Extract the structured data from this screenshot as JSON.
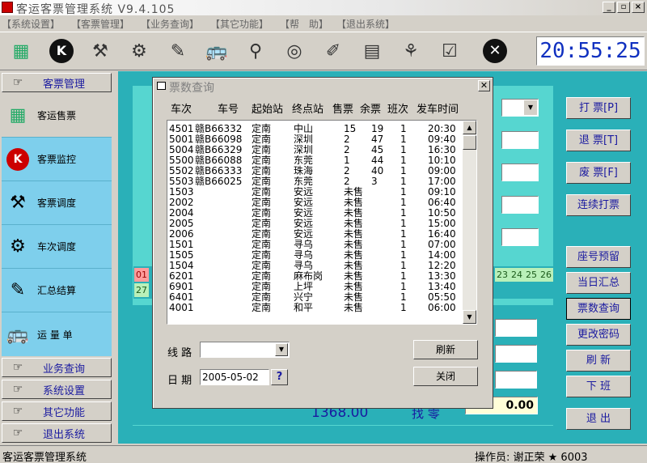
{
  "window": {
    "title": "客运客票管理系统 V9.4.105",
    "min": "_",
    "max": "▫",
    "close": "×"
  },
  "menu": [
    "【系统设置】",
    "【客票管理】",
    "【业务查询】",
    "【其它功能】",
    "【帮　助】",
    "【退出系统】"
  ],
  "clock": "20:55:25",
  "nav": {
    "headers": [
      "客票管理",
      "业务查询",
      "系统设置",
      "其它功能",
      "退出系统"
    ],
    "tiles": [
      "客运售票",
      "客票监控",
      "客票调度",
      "车次调度",
      "汇总结算",
      "运 量 单"
    ]
  },
  "side_buttons": [
    "打 票[P]",
    "退 票[T]",
    "废 票[F]",
    "连续打票",
    "座号预留",
    "当日汇总",
    "票数查询",
    "更改密码",
    "刷 新",
    "下 班",
    "退 出"
  ],
  "seats_row1": [
    "01"
  ],
  "seats_row1_right": [
    "23",
    "24",
    "25",
    "26"
  ],
  "seats_row2": [
    "27"
  ],
  "main": {
    "total_amount": "1368.00",
    "change_label": "找 零",
    "change_value": "0.00"
  },
  "dialog": {
    "title": "票数查询",
    "columns": [
      "车次",
      "车号",
      "起始站",
      "终点站",
      "售票",
      "余票",
      "班次",
      "发车时间"
    ],
    "rows": [
      [
        "4501",
        "赣B66332",
        "定南",
        "中山",
        "15",
        "19",
        "1",
        "20:30"
      ],
      [
        "5001",
        "赣B66098",
        "定南",
        "深圳",
        "2",
        "47",
        "1",
        "09:40"
      ],
      [
        "5004",
        "赣B66329",
        "定南",
        "深圳",
        "2",
        "45",
        "1",
        "16:30"
      ],
      [
        "5500",
        "赣B66088",
        "定南",
        "东莞",
        "1",
        "44",
        "1",
        "10:10"
      ],
      [
        "5502",
        "赣B66333",
        "定南",
        "珠海",
        "2",
        "40",
        "1",
        "09:00"
      ],
      [
        "5503",
        "赣B66025",
        "定南",
        "东莞",
        "2",
        "3",
        "1",
        "17:00"
      ],
      [
        "1503",
        "",
        "定南",
        "安远",
        "未售",
        "",
        "1",
        "09:10"
      ],
      [
        "2002",
        "",
        "定南",
        "安远",
        "未售",
        "",
        "1",
        "06:40"
      ],
      [
        "2004",
        "",
        "定南",
        "安远",
        "未售",
        "",
        "1",
        "10:50"
      ],
      [
        "2005",
        "",
        "定南",
        "安远",
        "未售",
        "",
        "1",
        "15:00"
      ],
      [
        "2006",
        "",
        "定南",
        "安远",
        "未售",
        "",
        "1",
        "16:40"
      ],
      [
        "1501",
        "",
        "定南",
        "寻乌",
        "未售",
        "",
        "1",
        "07:00"
      ],
      [
        "1505",
        "",
        "定南",
        "寻乌",
        "未售",
        "",
        "1",
        "14:00"
      ],
      [
        "1504",
        "",
        "定南",
        "寻乌",
        "未售",
        "",
        "1",
        "12:20"
      ],
      [
        "6201",
        "",
        "定南",
        "麻布岗",
        "未售",
        "",
        "1",
        "13:30"
      ],
      [
        "6901",
        "",
        "定南",
        "上坪",
        "未售",
        "",
        "1",
        "13:40"
      ],
      [
        "6401",
        "",
        "定南",
        "兴宁",
        "未售",
        "",
        "1",
        "05:50"
      ],
      [
        "4001",
        "",
        "定南",
        "和平",
        "未售",
        "",
        "1",
        "06:00"
      ]
    ],
    "route_label": "线 路",
    "date_label": "日 期",
    "date_value": "2005-05-02",
    "date_help": "?",
    "refresh_button": "刷新",
    "close_button": "关闭"
  },
  "status": {
    "app": "客运客票管理系统",
    "operator": "操作员: 谢正荣 ★ 6003"
  }
}
